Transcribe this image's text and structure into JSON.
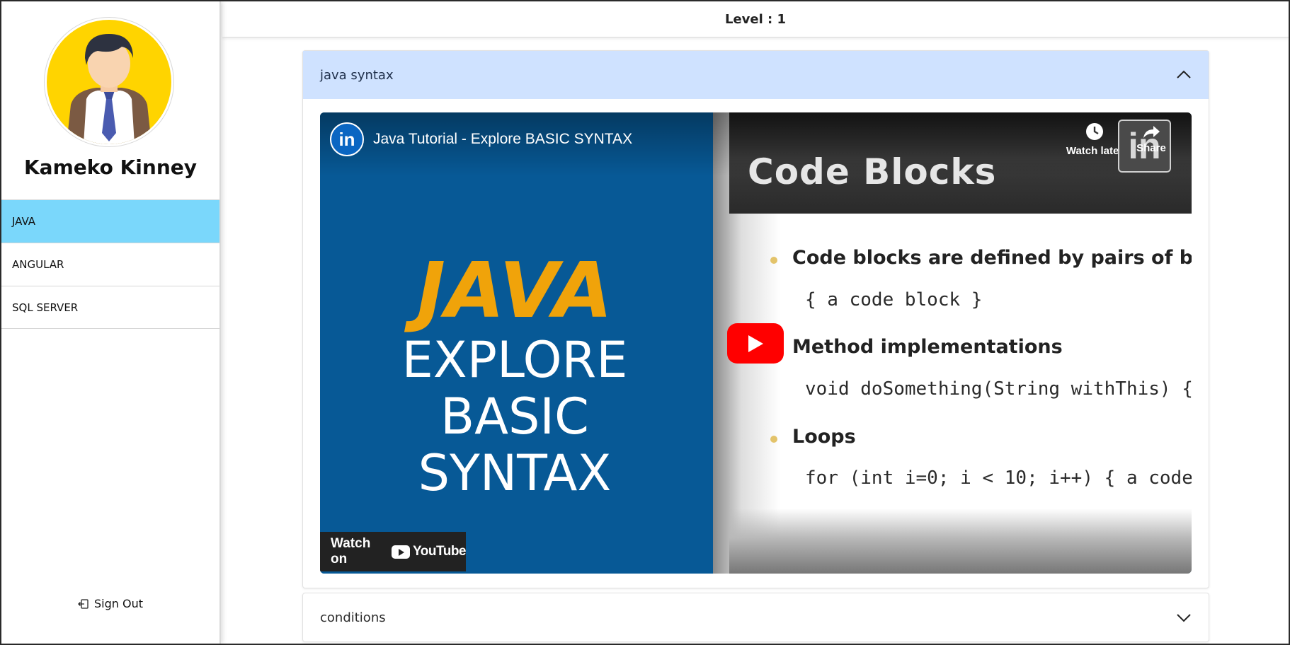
{
  "user": {
    "name": "Kameko Kinney"
  },
  "sidebar": {
    "items": [
      {
        "label": "JAVA",
        "active": true
      },
      {
        "label": "ANGULAR",
        "active": false
      },
      {
        "label": "SQL SERVER",
        "active": false
      }
    ],
    "sign_out_label": "Sign Out"
  },
  "header": {
    "level_text": "Level : 1"
  },
  "accordion": {
    "items": [
      {
        "title": "java syntax",
        "expanded": true
      },
      {
        "title": "conditions",
        "expanded": false
      }
    ]
  },
  "video": {
    "title": "Java Tutorial - Explore BASIC SYNTAX",
    "channel_logo_text": "in",
    "watch_later_label": "Watch later",
    "share_label": "Share",
    "thumbnail": {
      "java_text": "JAVA",
      "explore_line1": "EXPLORE BASIC",
      "explore_line2": "SYNTAX",
      "slide_title": "Code Blocks",
      "bullet1": "Code blocks are defined by pairs of braces",
      "code1": "{ a code block }",
      "bullet2": "Method implementations",
      "code2": "void doSomething(String withThis) {",
      "bullet3": "Loops",
      "code3": "for (int i=0; i < 10; i++) { a code"
    },
    "watch_on_label": "Watch on",
    "youtube_label": "YouTube"
  },
  "colors": {
    "active_nav": "#7ad7fb",
    "open_accordion_header": "#cfe2ff",
    "video_blue": "#075996",
    "java_orange": "#f0a30a",
    "play_red": "#ff0000"
  }
}
